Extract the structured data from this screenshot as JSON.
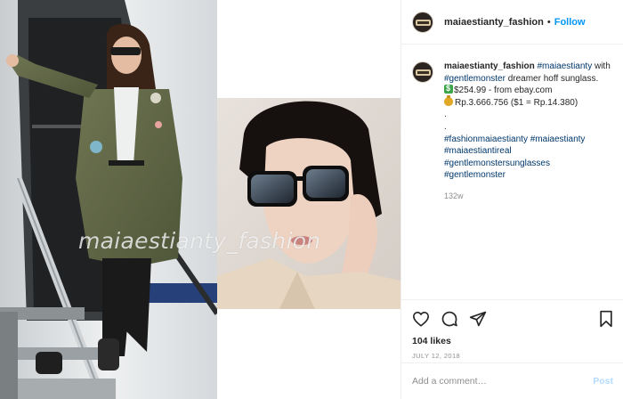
{
  "post": {
    "username": "maiaestianty_fashion",
    "separator": "•",
    "follow_label": "Follow",
    "watermark": "maiaestianty_fashion",
    "caption": {
      "username": "maiaestianty_fashion",
      "mention_1": "#maiaestianty",
      "text_with": " with ",
      "mention_2": "#gentlemonster",
      "text_product": " dreamer hoff sunglass.",
      "price_usd": "$254.99 - from ebay.com",
      "price_idr": "Rp.3.666.756 ($1 = Rp.14.380)",
      "dot_1": ".",
      "dot_2": ".",
      "hashtags_line_1a": "#fashionmaiaestianty",
      "hashtags_line_1b": "#maiaestianty",
      "hashtags_line_2": "#maiaestiantireal",
      "hashtags_line_3": "#gentlemonstersunglasses",
      "hashtags_line_4": "#gentlemonster",
      "time_ago": "132w"
    },
    "likes": "104 likes",
    "date": "JULY 12, 2018",
    "comment_placeholder": "Add a comment…",
    "post_label": "Post"
  },
  "colors": {
    "link_blue": "#0095f6",
    "hashtag": "#00376b",
    "muted": "#8e8e8e",
    "border": "#efefef"
  },
  "icons": [
    "heart-icon",
    "comment-icon",
    "share-icon",
    "bookmark-icon",
    "dollar-emoji-icon",
    "money-bag-emoji-icon"
  ]
}
